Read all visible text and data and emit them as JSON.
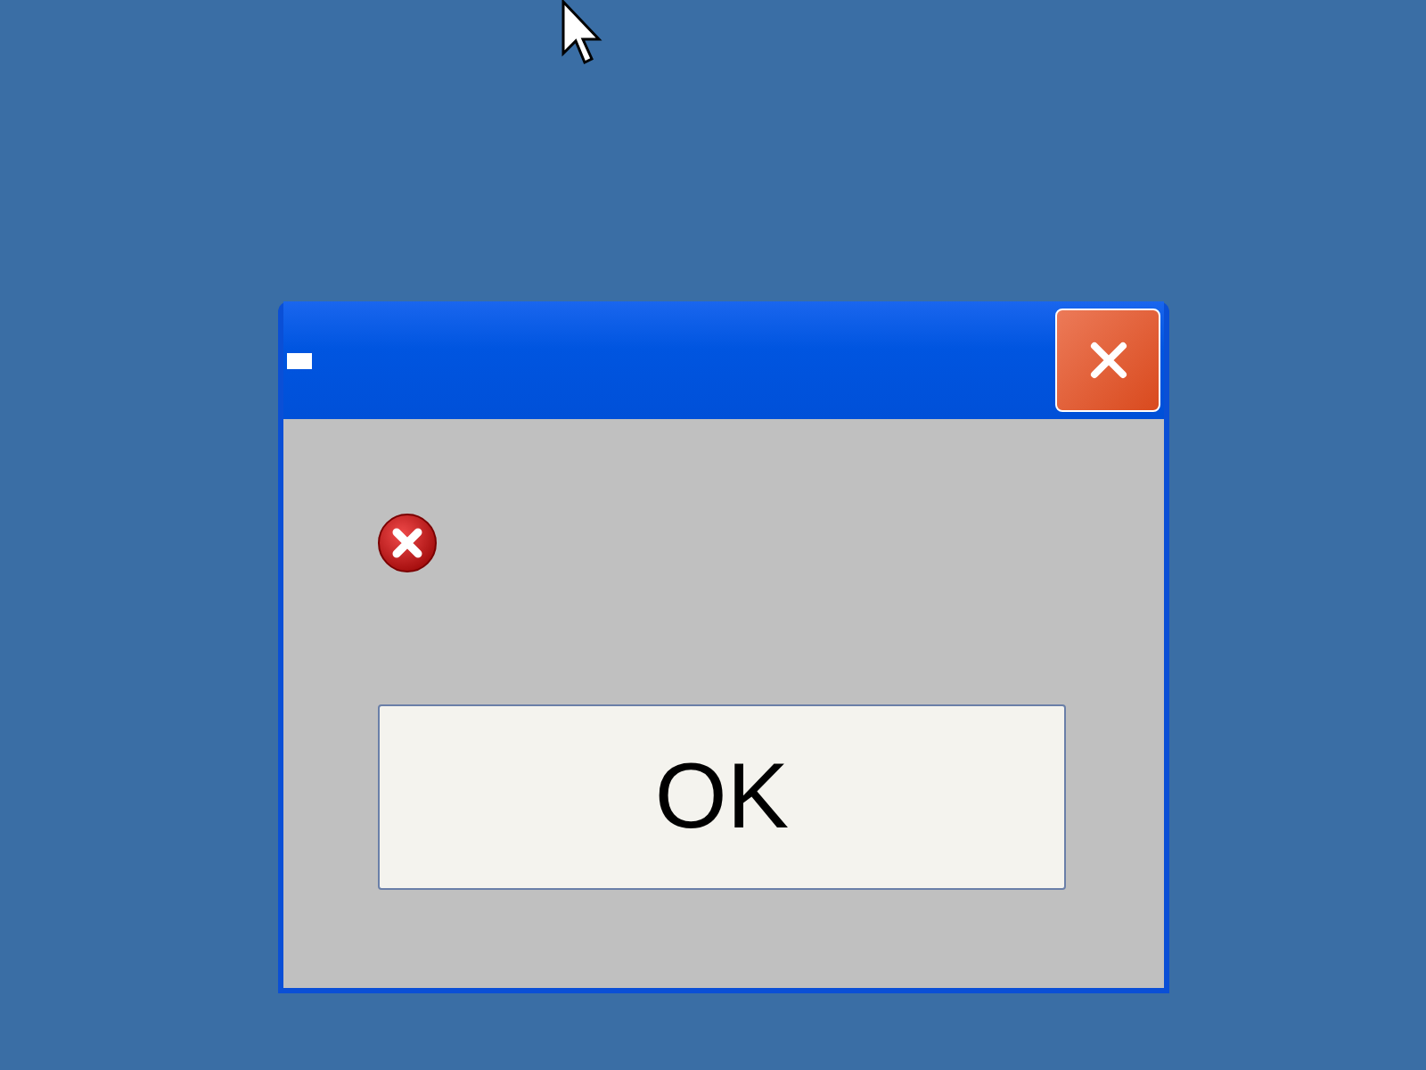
{
  "dialog": {
    "ok_button": "OK"
  }
}
